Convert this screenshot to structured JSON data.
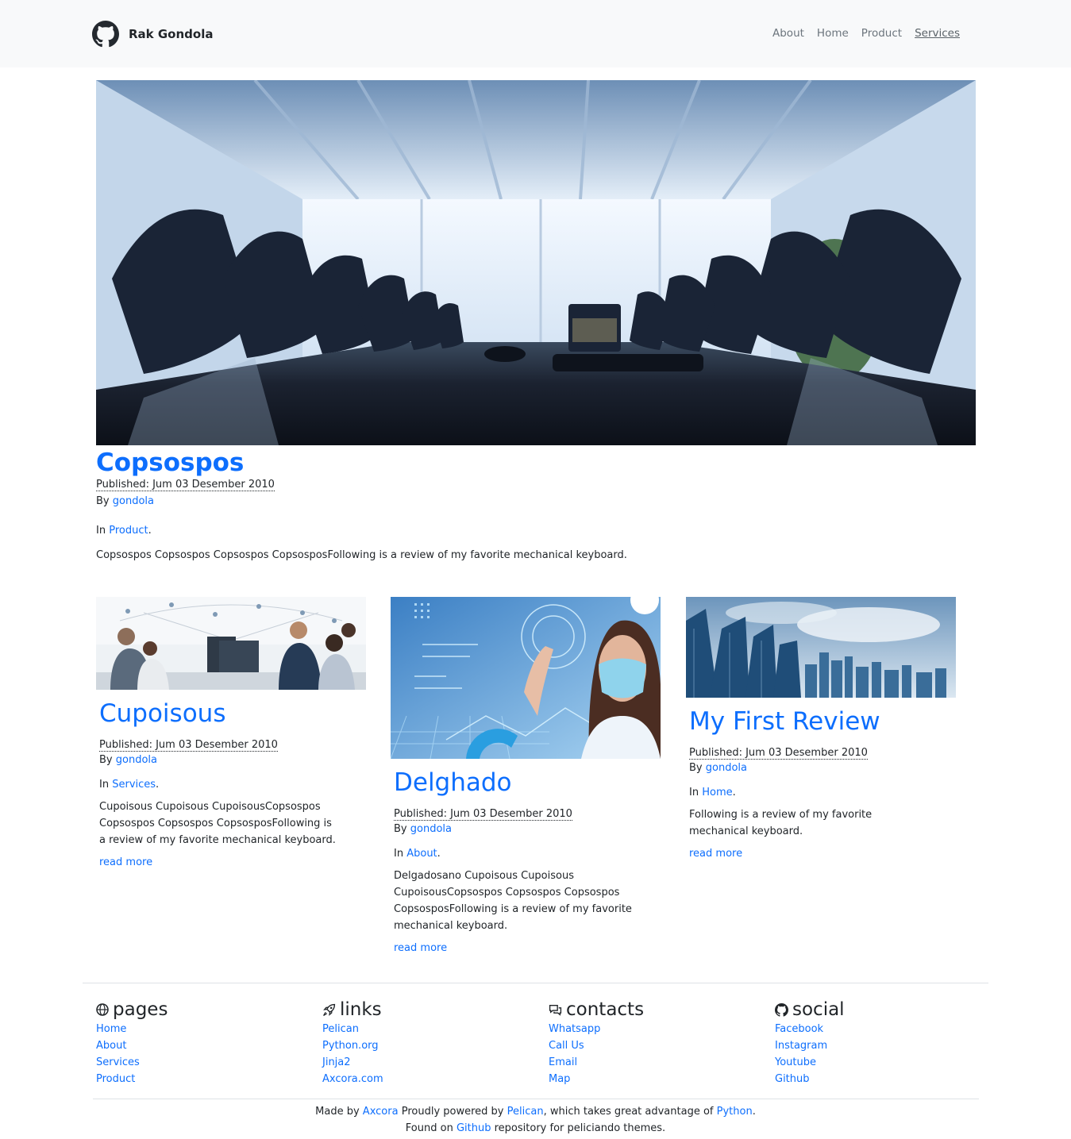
{
  "navbar": {
    "brand_name": "Rak Gondola",
    "brand_icon": "github-icon",
    "items": [
      "About",
      "Home",
      "Product",
      "Services"
    ],
    "active": "Services"
  },
  "hero": {
    "title": "Copsospos",
    "published": "Published: Jum 03 Desember 2010",
    "by_label": "By",
    "author": "gondola",
    "in_label": "In",
    "category": "Product",
    "summary": "Copsospos Copsospos Copsospos CopsosposFollowing is a review of my favorite mechanical keyboard."
  },
  "cards": [
    {
      "title": "Cupoisous",
      "published": "Published: Jum 03 Desember 2010",
      "by_label": "By",
      "author": "gondola",
      "in_label": "In",
      "category": "Services",
      "summary": "Cupoisous Cupoisous CupoisousCopsospos Copsospos Copsospos CopsosposFollowing is a review of my favorite mechanical keyboard.",
      "read_more": "read more"
    },
    {
      "title": "Delghado",
      "published": "Published: Jum 03 Desember 2010",
      "by_label": "By",
      "author": "gondola",
      "in_label": "In",
      "category": "About",
      "summary": "Delgadosano Cupoisous Cupoisous CupoisousCopsospos Copsospos Copsospos CopsosposFollowing is a review of my favorite mechanical keyboard.",
      "read_more": "read more"
    },
    {
      "title": "My First Review",
      "published": "Published: Jum 03 Desember 2010",
      "by_label": "By",
      "author": "gondola",
      "in_label": "In",
      "category": "Home",
      "summary": "Following is a review of my favorite mechanical keyboard.",
      "read_more": "read more"
    }
  ],
  "footer": {
    "columns": [
      {
        "title": "pages",
        "icon": "globe-icon",
        "links": [
          "Home",
          "About",
          "Services",
          "Product"
        ]
      },
      {
        "title": "links",
        "icon": "rocket-icon",
        "links": [
          "Pelican",
          "Python.org",
          "Jinja2",
          "Axcora.com"
        ]
      },
      {
        "title": "contacts",
        "icon": "chat-icon",
        "links": [
          "Whatsapp",
          "Call Us",
          "Email",
          "Map"
        ]
      },
      {
        "title": "social",
        "icon": "github-icon",
        "links": [
          "Facebook",
          "Instagram",
          "Youtube",
          "Github"
        ]
      }
    ],
    "credits": {
      "made_by": "Made by",
      "axcora": "Axcora",
      "powered": "Proudly powered by",
      "pelican": "Pelican",
      "advantage": ", which takes great advantage of",
      "python": "Python",
      "period": ".",
      "found_on": "Found on",
      "github": "Github",
      "repo": "repository for peliciando themes."
    }
  },
  "colors": {
    "link": "#0d6efd",
    "navbar_bg": "#f8f9fa",
    "nav_text": "#6c757d"
  }
}
